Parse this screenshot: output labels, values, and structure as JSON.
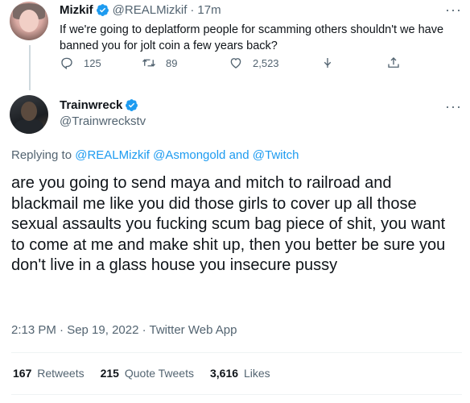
{
  "parent_tweet": {
    "author_name": "Mizkif",
    "author_handle": "@REALMizkif",
    "separator": "·",
    "time_ago": "17m",
    "text": "If we're going to deplatform people for scamming others shouldn't we have banned you for jolt coin a few years back?",
    "reply_count": "125",
    "retweet_count": "89",
    "like_count": "2,523"
  },
  "main_tweet": {
    "author_name": "Trainwreck",
    "author_handle": "@Trainwreckstv",
    "replying_prefix": "Replying to",
    "replying_links": "@REALMizkif @Asmongold and @Twitch",
    "text": "are you going to send maya and mitch to railroad and blackmail me like you did those girls to cover up all those sexual assaults you fucking scum bag piece of shit, you want to come at me and make shit up, then you better be sure you don't live in a glass house you insecure pussy",
    "timestamp": "2:13 PM · Sep 19, 2022 · Twitter Web App",
    "retweets_count": "167",
    "retweets_label": "Retweets",
    "quotes_count": "215",
    "quotes_label": "Quote Tweets",
    "likes_count": "3,616",
    "likes_label": "Likes"
  },
  "more_glyph": "···",
  "colors": {
    "link": "#1d9bf0",
    "muted": "#536471",
    "text": "#0f1419",
    "verified": "#1d9bf0"
  },
  "icons": [
    "verified-badge-icon",
    "reply-icon",
    "retweet-icon",
    "like-icon",
    "download-icon",
    "share-icon",
    "more-icon"
  ]
}
